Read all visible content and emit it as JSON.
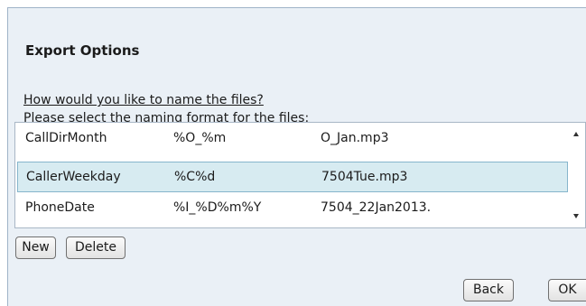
{
  "dialog": {
    "title": "Export Options",
    "question": "How would you like to name the files?",
    "instruction": "Please select the naming format for the files:"
  },
  "naming_formats": {
    "rows": [
      {
        "name": "CallDirMonth",
        "pattern": "%O_%m",
        "example": "O_Jan.mp3",
        "selected": false
      },
      {
        "name": "CallerWeekday",
        "pattern": "%C%d",
        "example": "7504Tue.mp3",
        "selected": true
      },
      {
        "name": "PhoneDate",
        "pattern": "%I_%D%m%Y",
        "example": "7504_22Jan2013.",
        "selected": false
      }
    ]
  },
  "buttons": {
    "new_label": "New",
    "delete_label": "Delete",
    "back_label": "Back",
    "ok_label": "OK"
  },
  "icons": {
    "scroll_up": "arrow-up-icon",
    "scroll_down": "arrow-down-icon"
  },
  "colors": {
    "dialog_background": "#eaf0f6",
    "selected_row": "#d7ebf1",
    "selected_border": "#86b5cc"
  }
}
